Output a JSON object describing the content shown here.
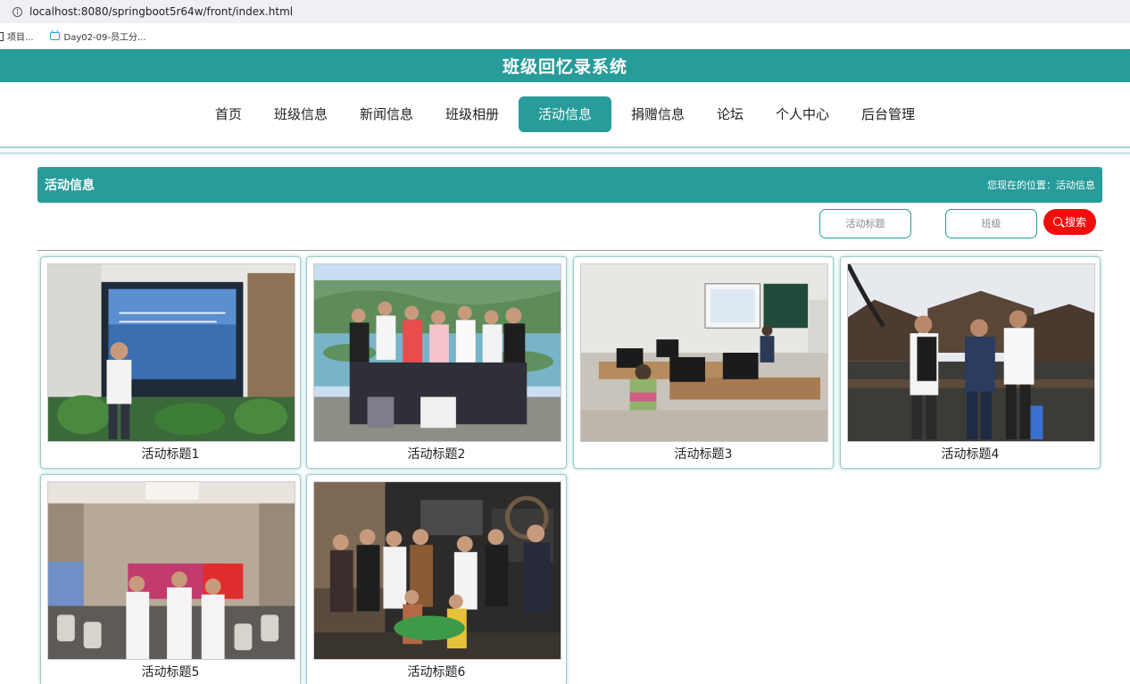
{
  "browser": {
    "url": "localhost:8080/springboot5r64w/front/index.html",
    "bookmarks": [
      {
        "label": "项目..."
      },
      {
        "label": "Day02-09-员工分..."
      }
    ]
  },
  "site": {
    "title": "班级回忆录系统"
  },
  "nav": {
    "items": [
      {
        "label": "首页"
      },
      {
        "label": "班级信息"
      },
      {
        "label": "新闻信息"
      },
      {
        "label": "班级相册"
      },
      {
        "label": "活动信息",
        "active": true
      },
      {
        "label": "捐赠信息"
      },
      {
        "label": "论坛"
      },
      {
        "label": "个人中心"
      },
      {
        "label": "后台管理"
      }
    ]
  },
  "section": {
    "title": "活动信息",
    "breadcrumb": "您现在的位置：活动信息"
  },
  "search": {
    "title_placeholder": "活动标题",
    "class_placeholder": "班级",
    "button_label": "搜索"
  },
  "activities": [
    {
      "title": "活动标题1"
    },
    {
      "title": "活动标题2"
    },
    {
      "title": "活动标题3"
    },
    {
      "title": "活动标题4"
    },
    {
      "title": "活动标题5"
    },
    {
      "title": "活动标题6"
    }
  ],
  "colors": {
    "accent": "#279c9a",
    "search_button": "#f20d0d"
  }
}
